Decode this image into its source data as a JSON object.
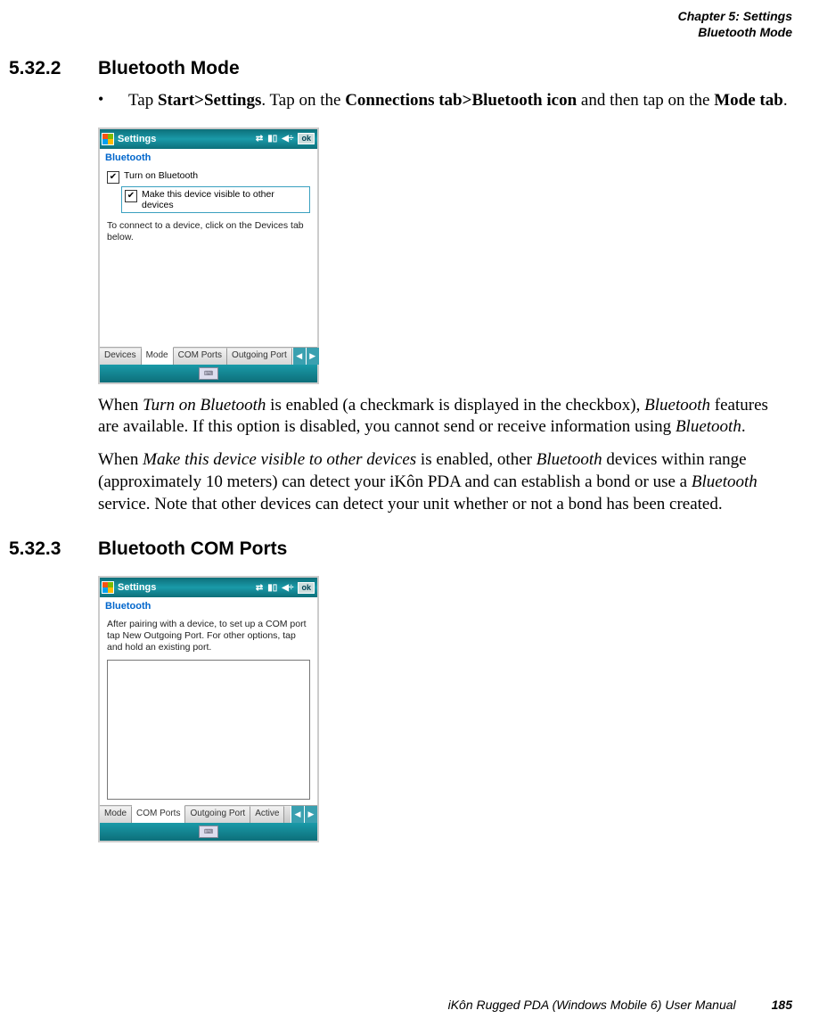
{
  "header": {
    "chapter": "Chapter 5:  Settings",
    "sub": "Bluetooth Mode"
  },
  "sec1": {
    "num": "5.32.2",
    "title": "Bluetooth Mode",
    "bullet_pre": "Tap ",
    "bullet_b1": "Start>Settings",
    "bullet_mid": ". Tap on the ",
    "bullet_b2": "Connections tab>Bluetooth icon",
    "bullet_mid2": " and then tap on the ",
    "bullet_b3": "Mode tab",
    "bullet_end": ".",
    "p1a": "When ",
    "p1i1": "Turn on Bluetooth",
    "p1b": " is enabled (a checkmark is displayed in the checkbox), ",
    "p1i2": "Bluetooth",
    "p1c": " features are available. If this option is disabled, you cannot send or receive information using ",
    "p1i3": "Bluetooth",
    "p1d": ".",
    "p2a": "When ",
    "p2i1": "Make this device visible to other devices",
    "p2b": " is enabled, other ",
    "p2i2": "Bluetooth",
    "p2c": " devices within range (approximately 10 meters) can detect your iKôn PDA and can establish a bond or use a ",
    "p2i3": "Bluetooth",
    "p2d": " service. Note that other devices can detect your unit whether or not a bond has been created."
  },
  "sec2": {
    "num": "5.32.3",
    "title": "Bluetooth COM Ports"
  },
  "shot1": {
    "title": "Settings",
    "ok": "ok",
    "subtitle": "Bluetooth",
    "check1": "Turn on Bluetooth",
    "check2": "Make this device visible to other devices",
    "hint": "To connect to a device, click on the Devices tab below.",
    "tabs": [
      "Devices",
      "Mode",
      "COM Ports",
      "Outgoing Port"
    ]
  },
  "shot2": {
    "title": "Settings",
    "ok": "ok",
    "subtitle": "Bluetooth",
    "hint": "After pairing with a device, to set up a COM port tap New Outgoing Port. For other options, tap and hold an existing port.",
    "tabs": [
      "Mode",
      "COM Ports",
      "Outgoing Port",
      "Active"
    ]
  },
  "footer": {
    "text": "iKôn Rugged PDA (Windows Mobile 6) User Manual",
    "page": "185"
  }
}
